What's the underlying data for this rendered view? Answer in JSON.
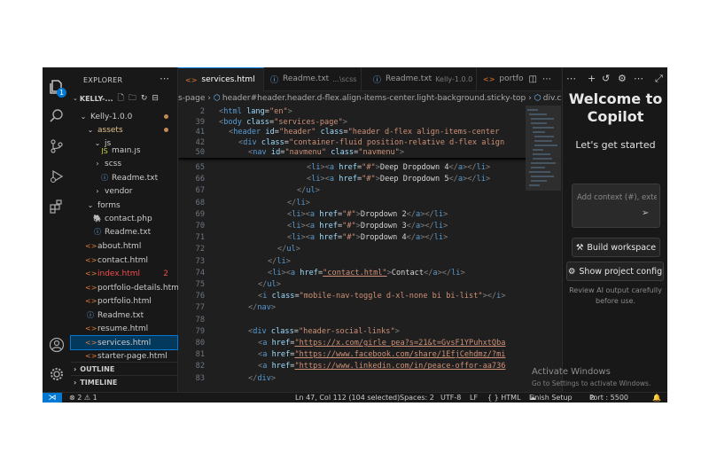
{
  "sidebar": {
    "title": "EXPLORER",
    "project_short": "KELLY-...",
    "tree": [
      {
        "label": "Kelly-1.0.0",
        "type": "folder-open",
        "indent": 0,
        "status": "dot"
      },
      {
        "label": "assets",
        "type": "folder-open",
        "indent": 1,
        "status": "dot",
        "modified": true
      },
      {
        "label": "js",
        "type": "folder-open",
        "indent": 2
      },
      {
        "label": "main.js",
        "type": "js",
        "indent": 3
      },
      {
        "label": "scss",
        "type": "folder",
        "indent": 2
      },
      {
        "label": "Readme.txt",
        "type": "info",
        "indent": 3
      },
      {
        "label": "vendor",
        "type": "folder",
        "indent": 2
      },
      {
        "label": "forms",
        "type": "folder-open",
        "indent": 1
      },
      {
        "label": "contact.php",
        "type": "php",
        "indent": 2
      },
      {
        "label": "Readme.txt",
        "type": "info",
        "indent": 2
      },
      {
        "label": "about.html",
        "type": "html",
        "indent": 1
      },
      {
        "label": "contact.html",
        "type": "html",
        "indent": 1
      },
      {
        "label": "index.html",
        "type": "html",
        "indent": 1,
        "error": "2"
      },
      {
        "label": "portfolio-details.html",
        "type": "html",
        "indent": 1
      },
      {
        "label": "portfolio.html",
        "type": "html",
        "indent": 1
      },
      {
        "label": "Readme.txt",
        "type": "info",
        "indent": 1
      },
      {
        "label": "resume.html",
        "type": "html",
        "indent": 1
      },
      {
        "label": "services.html",
        "type": "html",
        "indent": 1,
        "selected": true
      },
      {
        "label": "starter-page.html",
        "type": "html",
        "indent": 1
      }
    ],
    "sections": [
      "OUTLINE",
      "TIMELINE"
    ]
  },
  "tabs": [
    {
      "label": "services.html",
      "icon": "<>",
      "active": true
    },
    {
      "label": "Readme.txt",
      "desc": "...\\scss",
      "icon": "ⓘ"
    },
    {
      "label": "Readme.txt",
      "desc": "Kelly-1.0.0",
      "icon": "ⓘ"
    },
    {
      "label": "portfo",
      "icon": "<>"
    }
  ],
  "breadcrumb": [
    "s-page",
    "header#header.header.d-flex.align-items-center.light-background.sticky-top",
    "div.containe"
  ],
  "sticky_lines": [
    {
      "n": "2",
      "html": "<span class='p'>&lt;</span><span class='t'>html</span> <span class='a'>lang</span><span class='x'>=</span><span class='s'>\"en\"</span><span class='p'>&gt;</span>",
      "indent": 0
    },
    {
      "n": "39",
      "html": "<span class='p'>&lt;</span><span class='t'>body</span> <span class='a'>class</span><span class='x'>=</span><span class='s'>\"services-page\"</span><span class='p'>&gt;</span>",
      "indent": 0
    },
    {
      "n": "41",
      "html": "<span class='p'>&lt;</span><span class='t'>header</span> <span class='a'>id</span><span class='x'>=</span><span class='s'>\"header\"</span> <span class='a'>class</span><span class='x'>=</span><span class='s'>\"header d-flex align-items-center</span>",
      "indent": 1
    },
    {
      "n": "42",
      "html": "<span class='p'>&lt;</span><span class='t'>div</span> <span class='a'>class</span><span class='x'>=</span><span class='s'>\"container-fluid position-relative d-flex align</span>",
      "indent": 2
    },
    {
      "n": "50",
      "html": "<span class='p'>&lt;</span><span class='t'>nav</span> <span class='a'>id</span><span class='x'>=</span><span class='s'>\"navmenu\"</span> <span class='a'>class</span><span class='x'>=</span><span class='s'>\"navmenu\"</span><span class='p'>&gt;</span>",
      "indent": 3
    }
  ],
  "code_lines": [
    {
      "n": "65",
      "html": "<span class='p'>&lt;</span><span class='t'>li</span><span class='p'>&gt;&lt;</span><span class='t'>a</span> <span class='a'>href</span><span class='x'>=</span><span class='s'>\"#\"</span><span class='p'>&gt;</span><span class='x'>Deep Dropdown 4</span><span class='p'>&lt;/</span><span class='t'>a</span><span class='p'>&gt;&lt;/</span><span class='t'>li</span><span class='p'>&gt;</span>",
      "indent": 9
    },
    {
      "n": "66",
      "html": "<span class='p'>&lt;</span><span class='t'>li</span><span class='p'>&gt;&lt;</span><span class='t'>a</span> <span class='a'>href</span><span class='x'>=</span><span class='s'>\"#\"</span><span class='p'>&gt;</span><span class='x'>Deep Dropdown 5</span><span class='p'>&lt;/</span><span class='t'>a</span><span class='p'>&gt;&lt;/</span><span class='t'>li</span><span class='p'>&gt;</span>",
      "indent": 9
    },
    {
      "n": "67",
      "html": "<span class='p'>&lt;/</span><span class='t'>ul</span><span class='p'>&gt;</span>",
      "indent": 8
    },
    {
      "n": "68",
      "html": "<span class='p'>&lt;/</span><span class='t'>li</span><span class='p'>&gt;</span>",
      "indent": 7
    },
    {
      "n": "69",
      "html": "<span class='p'>&lt;</span><span class='t'>li</span><span class='p'>&gt;&lt;</span><span class='t'>a</span> <span class='a'>href</span><span class='x'>=</span><span class='s'>\"#\"</span><span class='p'>&gt;</span><span class='x'>Dropdown 2</span><span class='p'>&lt;/</span><span class='t'>a</span><span class='p'>&gt;&lt;/</span><span class='t'>li</span><span class='p'>&gt;</span>",
      "indent": 7
    },
    {
      "n": "70",
      "html": "<span class='p'>&lt;</span><span class='t'>li</span><span class='p'>&gt;&lt;</span><span class='t'>a</span> <span class='a'>href</span><span class='x'>=</span><span class='s'>\"#\"</span><span class='p'>&gt;</span><span class='x'>Dropdown 3</span><span class='p'>&lt;/</span><span class='t'>a</span><span class='p'>&gt;&lt;/</span><span class='t'>li</span><span class='p'>&gt;</span>",
      "indent": 7
    },
    {
      "n": "71",
      "html": "<span class='p'>&lt;</span><span class='t'>li</span><span class='p'>&gt;&lt;</span><span class='t'>a</span> <span class='a'>href</span><span class='x'>=</span><span class='s'>\"#\"</span><span class='p'>&gt;</span><span class='x'>Dropdown 4</span><span class='p'>&lt;/</span><span class='t'>a</span><span class='p'>&gt;&lt;/</span><span class='t'>li</span><span class='p'>&gt;</span>",
      "indent": 7
    },
    {
      "n": "72",
      "html": "<span class='p'>&lt;/</span><span class='t'>ul</span><span class='p'>&gt;</span>",
      "indent": 6
    },
    {
      "n": "73",
      "html": "<span class='p'>&lt;/</span><span class='t'>li</span><span class='p'>&gt;</span>",
      "indent": 5
    },
    {
      "n": "74",
      "html": "<span class='p'>&lt;</span><span class='t'>li</span><span class='p'>&gt;&lt;</span><span class='t'>a</span> <span class='a'>href</span><span class='x'>=</span><span class='s u'>\"contact.html\"</span><span class='p'>&gt;</span><span class='x'>Contact</span><span class='p'>&lt;/</span><span class='t'>a</span><span class='p'>&gt;&lt;/</span><span class='t'>li</span><span class='p'>&gt;</span>",
      "indent": 5
    },
    {
      "n": "75",
      "html": "<span class='p'>&lt;/</span><span class='t'>ul</span><span class='p'>&gt;</span>",
      "indent": 4
    },
    {
      "n": "76",
      "html": "<span class='p'>&lt;</span><span class='t'>i</span> <span class='a'>class</span><span class='x'>=</span><span class='s'>\"mobile-nav-toggle d-xl-none bi bi-list\"</span><span class='p'>&gt;&lt;/</span><span class='t'>i</span><span class='p'>&gt;</span>",
      "indent": 4
    },
    {
      "n": "77",
      "html": "<span class='p'>&lt;/</span><span class='t'>nav</span><span class='p'>&gt;</span>",
      "indent": 3
    },
    {
      "n": "78",
      "html": "",
      "indent": 0
    },
    {
      "n": "79",
      "html": "<span class='p'>&lt;</span><span class='t'>div</span> <span class='a'>class</span><span class='x'>=</span><span class='s'>\"header-social-links\"</span><span class='p'>&gt;</span>",
      "indent": 3
    },
    {
      "n": "80",
      "html": "<span class='p'>&lt;</span><span class='t'>a</span> <span class='a'>href</span><span class='x'>=</span><span class='s u'>\"https://x.com/girle_pea?s=21&amp;t=GvsF1YPuhxtQba</span>",
      "indent": 4
    },
    {
      "n": "81",
      "html": "<span class='p'>&lt;</span><span class='t'>a</span> <span class='a'>href</span><span class='x'>=</span><span class='s u'>\"https://www.facebook.com/share/1EfjCehdmz/?mi</span>",
      "indent": 4
    },
    {
      "n": "82",
      "html": "<span class='p'>&lt;</span><span class='t'>a</span> <span class='a'>href</span><span class='x'>=</span><span class='s u'>\"https://www.linkedin.com/in/peace-offor-aa736</span>",
      "indent": 4
    },
    {
      "n": "83",
      "html": "<span class='p'>&lt;/</span><span class='t'>div</span><span class='p'>&gt;</span>",
      "indent": 3
    }
  ],
  "copilot": {
    "title_line1": "Welcome to",
    "title_line2": "Copilot",
    "subtitle": "Let's get started",
    "input_placeholder": "Add context (#), exten",
    "build_label": "Build workspace",
    "project_config_label": "Show project config",
    "note": "Review AI output carefully before use."
  },
  "watermark": {
    "title": "Activate Windows",
    "subtitle": "Go to Settings to activate Windows."
  },
  "status": {
    "problems": "⊗ 2 ⚠ 1",
    "position": "Ln 47, Col 112 (104 selected)",
    "spaces": "Spaces: 2",
    "encoding": "UTF-8",
    "eol": "LF",
    "language": "{ } HTML",
    "finish_setup": "Finish Setup",
    "port": "Port : 5500"
  },
  "colors": {
    "accent": "#0078d4",
    "background": "#1e1e1e",
    "tag": "#569cd6",
    "attribute": "#9cdcfe",
    "string": "#ce9178",
    "html_icon": "#e37933",
    "error": "#f14c4c"
  }
}
